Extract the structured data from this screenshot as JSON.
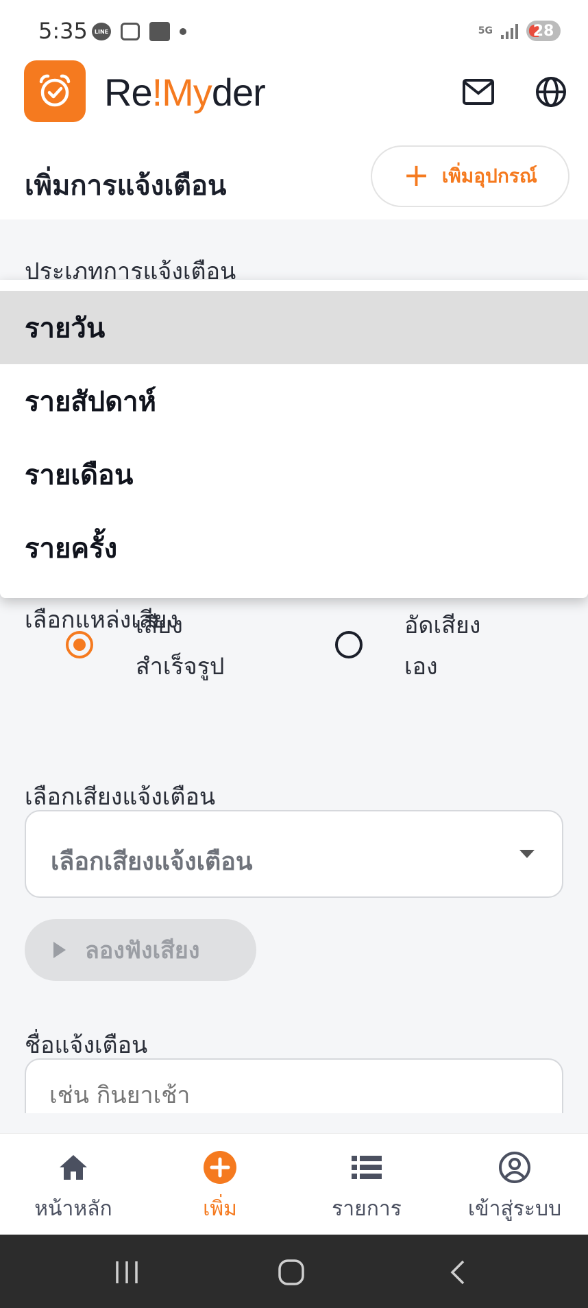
{
  "status_bar": {
    "time": "5:35",
    "network": "5G",
    "battery": "28"
  },
  "app": {
    "brand_prefix": "Re",
    "brand_accent": "!My",
    "brand_suffix": "der",
    "accent_color": "#f57a1f",
    "icons": [
      "alarm-clock-icon",
      "mail-icon",
      "globe-icon"
    ]
  },
  "title_row": {
    "title": "เพิ่มการแจ้งเตือน",
    "add_device_label": "เพิ่มอุปกรณ์",
    "add_device_icon": "plus-icon"
  },
  "form": {
    "reminder_type_label": "ประเภทการแจ้งเตือน",
    "sound_source_label": "เลือกแหล่งเสียง",
    "sound_source_options": [
      {
        "label_line1": "เสียง",
        "label_line2": "สำเร็จรูป",
        "selected": true
      },
      {
        "label_line1": "อัดเสียง",
        "label_line2": "เอง",
        "selected": false
      }
    ],
    "sound_label": "เลือกเสียงแจ้งเตือน",
    "sound_select_value": "เลือกเสียงแจ้งเตือน",
    "preview_label": "ลองฟังเสียง",
    "name_label": "ชื่อแจ้งเตือน",
    "name_placeholder": "เช่น กินยาเช้า"
  },
  "dropdown": {
    "items": [
      {
        "label": "รายวัน",
        "selected": true
      },
      {
        "label": "รายสัปดาห์",
        "selected": false
      },
      {
        "label": "รายเดือน",
        "selected": false
      },
      {
        "label": "รายครั้ง",
        "selected": false
      }
    ]
  },
  "bottom_nav": {
    "items": [
      {
        "label": "หน้าหลัก",
        "icon": "home-icon",
        "active": false
      },
      {
        "label": "เพิ่ม",
        "icon": "add-circle-icon",
        "active": true
      },
      {
        "label": "รายการ",
        "icon": "list-icon",
        "active": false
      },
      {
        "label": "เข้าสู่ระบบ",
        "icon": "user-circle-icon",
        "active": false
      }
    ]
  }
}
